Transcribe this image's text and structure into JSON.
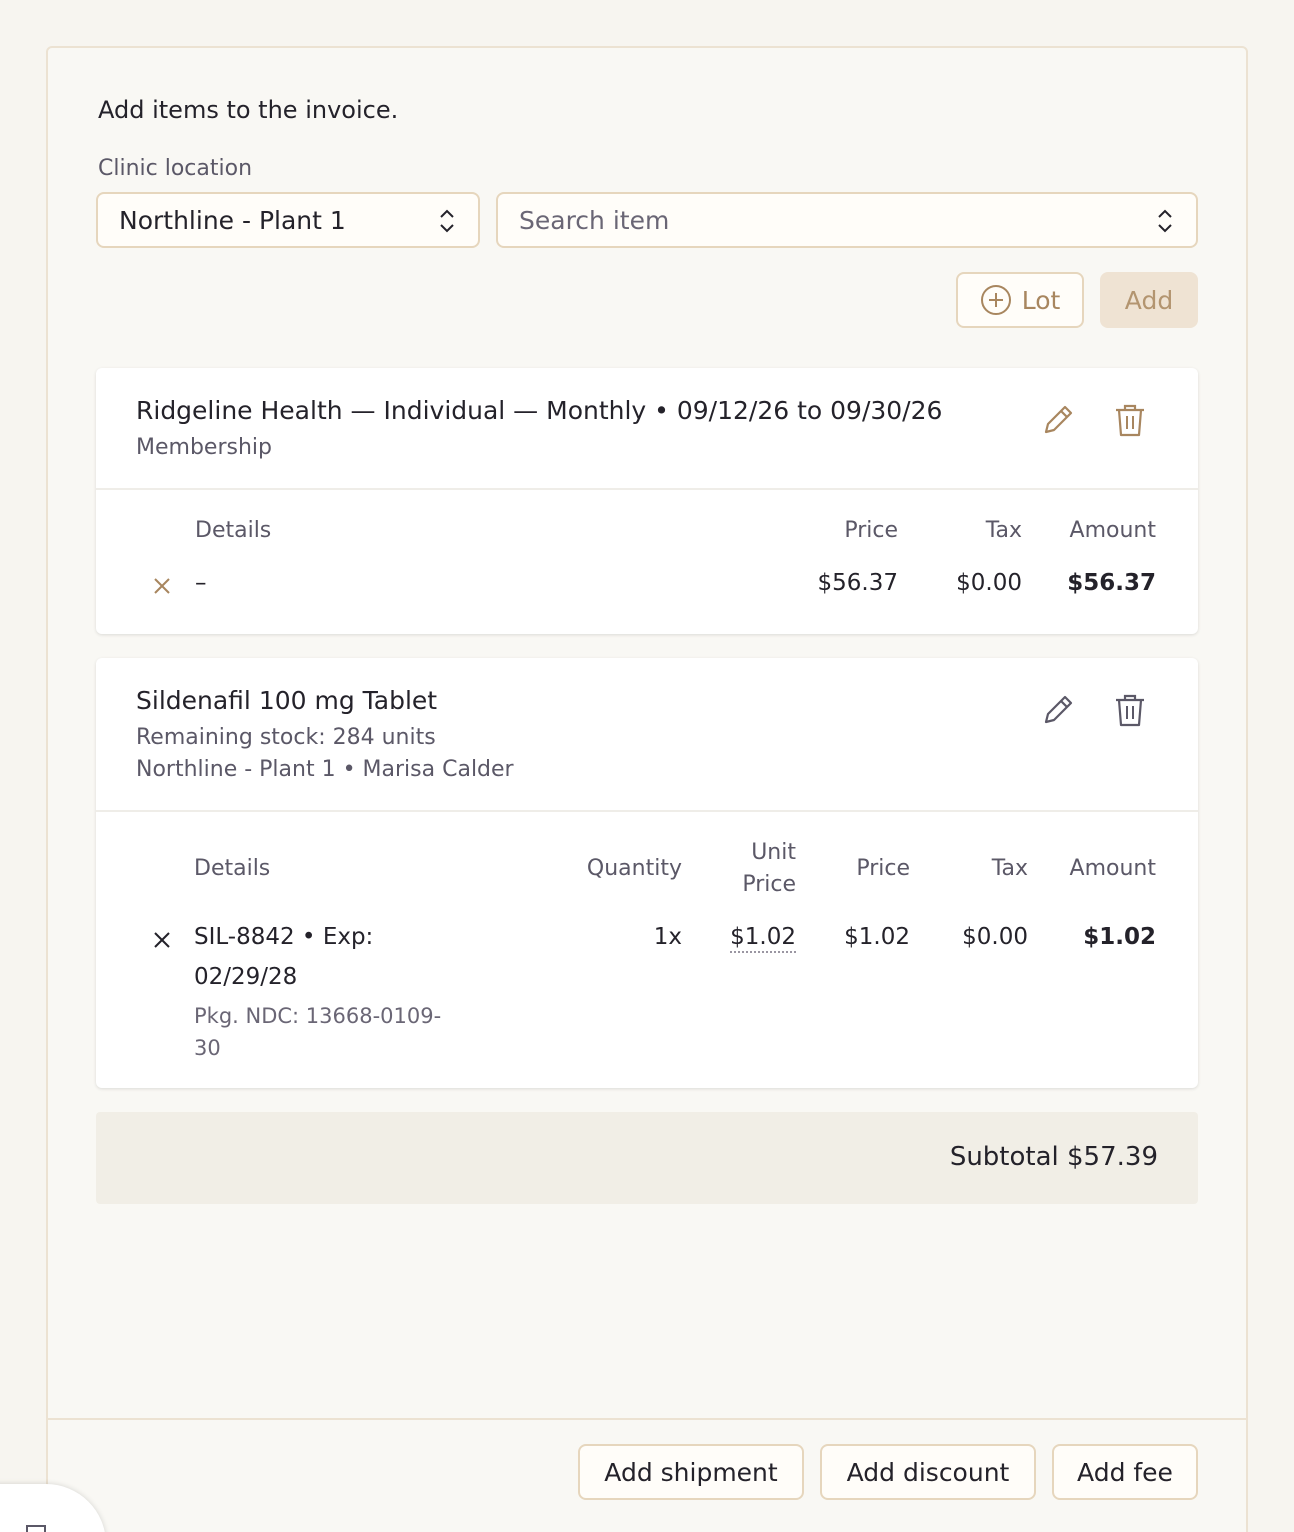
{
  "intro_text": "Add items to the invoice.",
  "clinic_location_label": "Clinic location",
  "clinic_location_value": "Northline - Plant 1",
  "search_placeholder": "Search item",
  "buttons": {
    "lot": "Lot",
    "add": "Add"
  },
  "item1": {
    "title": "Ridgeline Health — Individual — Monthly • 09/12/26 to 09/30/26",
    "subtitle": "Membership",
    "headers": {
      "details": "Details",
      "price": "Price",
      "tax": "Tax",
      "amount": "Amount"
    },
    "row": {
      "details": "–",
      "price": "$56.37",
      "tax": "$0.00",
      "amount": "$56.37"
    }
  },
  "item2": {
    "title": "Sildenafil 100 mg Tablet",
    "stock": "Remaining stock: 284 units",
    "location": "Northline - Plant 1 • Marisa Calder",
    "headers": {
      "details": "Details",
      "quantity": "Quantity",
      "unit": "Unit",
      "unit_price": "Price",
      "price": "Price",
      "tax": "Tax",
      "amount": "Amount"
    },
    "row": {
      "details_line1": "SIL-8842 • Exp:",
      "details_line2": "02/29/28",
      "ndc_line1": "Pkg. NDC: 13668-0109-",
      "ndc_line2": "30",
      "quantity": "1x",
      "unit_price": "$1.02",
      "price": "$1.02",
      "tax": "$0.00",
      "amount": "$1.02"
    }
  },
  "subtotal": "Subtotal $57.39",
  "footer_buttons": {
    "shipment": "Add shipment",
    "discount": "Add discount",
    "fee": "Add fee"
  },
  "colors": {
    "accent": "#a8865f",
    "border": "#e6d6bd",
    "background": "#f7f5f0"
  }
}
